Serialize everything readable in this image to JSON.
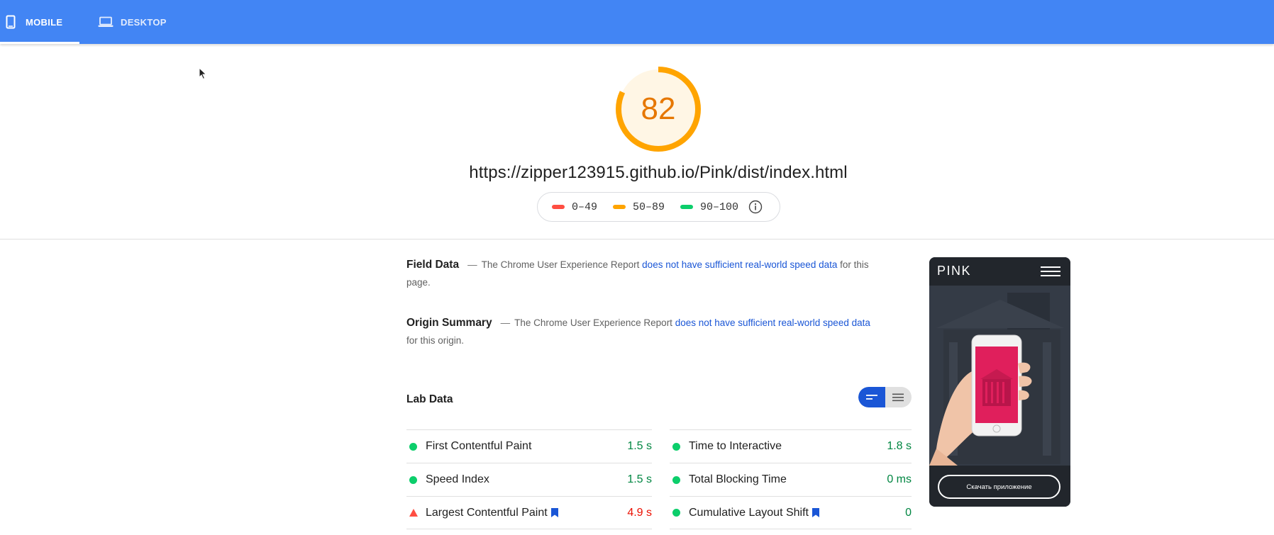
{
  "tabs": {
    "mobile_label": "MOBILE",
    "desktop_label": "DESKTOP",
    "active": "MOBILE"
  },
  "report": {
    "score": "82",
    "score_fraction": 0.82,
    "url": "https://zipper123915.github.io/Pink/dist/index.html",
    "colors": {
      "average": "#ffa400",
      "pass": "#0cce6b",
      "fail": "#ff4e42",
      "link": "#1a56d6"
    }
  },
  "legend": {
    "fail_range": "0–49",
    "average_range": "50–89",
    "pass_range": "90–100"
  },
  "field_data": {
    "title": "Field Data",
    "dash": "—",
    "text_before": "The Chrome User Experience Report ",
    "link": "does not have sufficient real-world speed data",
    "text_after": " for this page."
  },
  "origin_summary": {
    "title": "Origin Summary",
    "dash": "—",
    "text_before": "The Chrome User Experience Report ",
    "link": "does not have sufficient real-world speed data",
    "text_after": " for this origin."
  },
  "lab_data": {
    "title": "Lab Data",
    "metrics_left": [
      {
        "label": "First Contentful Paint",
        "value": "1.5 s",
        "status": "pass"
      },
      {
        "label": "Speed Index",
        "value": "1.5 s",
        "status": "pass"
      },
      {
        "label": "Largest Contentful Paint",
        "value": "4.9 s",
        "status": "fail"
      }
    ],
    "metrics_right": [
      {
        "label": "Time to Interactive",
        "value": "1.8 s",
        "status": "pass"
      },
      {
        "label": "Total Blocking Time",
        "value": "0 ms",
        "status": "pass"
      },
      {
        "label": "Cumulative Layout Shift",
        "value": "0",
        "status": "pass"
      }
    ]
  },
  "thumbnail": {
    "logo": "PINK",
    "button": "Скачать приложение"
  }
}
